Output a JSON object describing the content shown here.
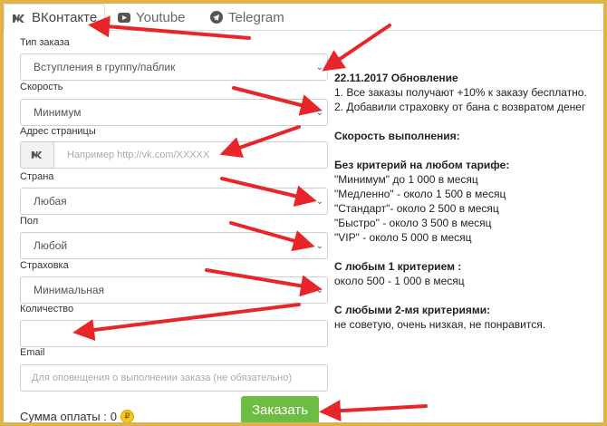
{
  "tabs": [
    {
      "label": "ВКонтакте",
      "icon": "vk-icon",
      "active": true
    },
    {
      "label": "Youtube",
      "icon": "youtube-icon",
      "active": false
    },
    {
      "label": "Telegram",
      "icon": "telegram-icon",
      "active": false
    }
  ],
  "form": {
    "order_type": {
      "label": "Тип заказа",
      "value": "Вступления в группу/паблик"
    },
    "speed": {
      "label": "Скорость",
      "value": "Минимум"
    },
    "page_address": {
      "label": "Адрес страницы",
      "placeholder": "Например http://vk.com/XXXXX"
    },
    "country": {
      "label": "Страна",
      "value": "Любая"
    },
    "gender": {
      "label": "Пол",
      "value": "Любой"
    },
    "insurance": {
      "label": "Страховка",
      "value": "Минимальная"
    },
    "quantity": {
      "label": "Количество",
      "value": ""
    },
    "email": {
      "label": "Email",
      "placeholder": "Для оповещения о выполнении заказа (не обязательно)"
    }
  },
  "sum": {
    "label": "Сумма оплаты :",
    "value": "0"
  },
  "order_button": "Заказать",
  "info": {
    "update_title": "22.11.2017 Обновление",
    "update_items": [
      "1. Все заказы получают +10% к заказу бесплатно.",
      "2. Добавили страховку от бана с возвратом денег"
    ],
    "speed_title": "Скорость выполнения:",
    "no_criteria_title": "Без критерий на любом тарифе:",
    "no_criteria_items": [
      "\"Минимум\"  до 1 000 в месяц",
      "\"Медленно\" - около 1 500 в месяц",
      "\"Стандарт\"- около 2 500 в месяц",
      "\"Быстро\" - около 3 500 в месяц",
      "\"VIP\" - около 5 000 в месяц"
    ],
    "one_criterion_title": "С любым 1 критерием :",
    "one_criterion_text": "около 500 - 1 000 в месяц",
    "two_criteria_title": "С любыми 2-мя критериями:",
    "two_criteria_text": "не советую, очень низкая, не понравится."
  },
  "colors": {
    "frame": "#e0b24a",
    "arrow": "#e8262a",
    "button": "#6dbd45"
  }
}
